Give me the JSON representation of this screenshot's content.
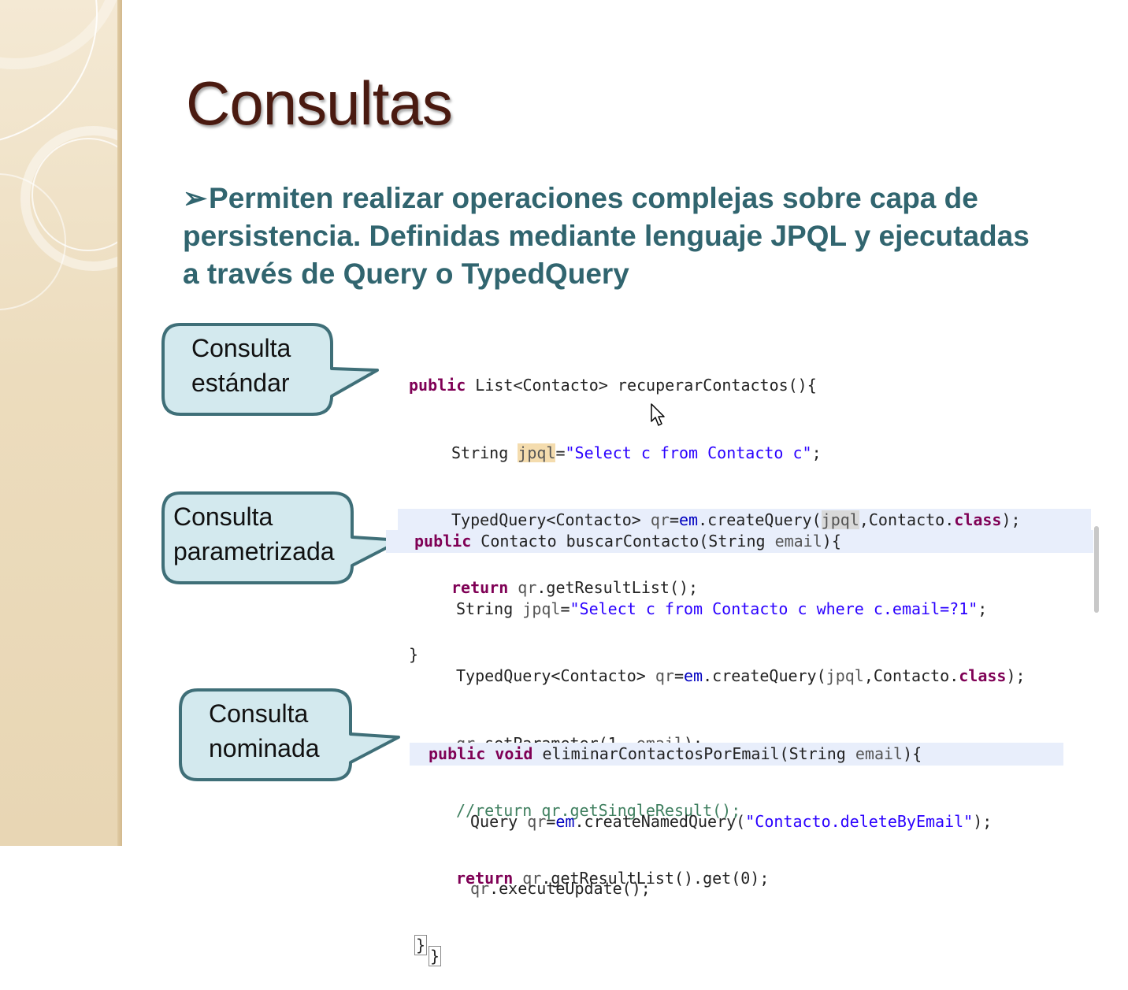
{
  "slide": {
    "title": "Consultas",
    "bullet_arrow": "➢",
    "bullet_text": "Permiten realizar operaciones complejas sobre capa de persistencia. Definidas mediante lenguaje JPQL y ejecutadas a través de Query o TypedQuery"
  },
  "callouts": [
    {
      "line1": "Consulta",
      "line2": "estándar"
    },
    {
      "line1": "Consulta",
      "line2": "parametrizada"
    },
    {
      "line1": "Consulta",
      "line2": "nominada"
    }
  ],
  "code_standard": {
    "l1_kw": "public",
    "l1_rest": " List<Contacto> recuperarContactos(){",
    "l2_a": "String ",
    "l2_var": "jpql",
    "l2_b": "=",
    "l2_str": "\"Select c from Contacto c\"",
    "l2_c": ";",
    "l3_a": "TypedQuery<Contacto> ",
    "l3_qr": "qr",
    "l3_b": "=",
    "l3_em": "em",
    "l3_c": ".createQuery(",
    "l3_var": "jpql",
    "l3_d": ",Contacto.",
    "l3_kw": "class",
    "l3_e": ");",
    "l4_kw": "return",
    "l4_qr": " qr",
    "l4_rest": ".getResultList();",
    "l5": "}"
  },
  "code_param": {
    "l1_kw": "public",
    "l1_a": " Contacto buscarContacto(String ",
    "l1_var": "email",
    "l1_b": "){",
    "l2_a": "String ",
    "l2_var": "jpql",
    "l2_b": "=",
    "l2_str": "\"Select c from Contacto c where c.email=?1\"",
    "l2_c": ";",
    "l3_a": "TypedQuery<Contacto> ",
    "l3_qr": "qr",
    "l3_b": "=",
    "l3_em": "em",
    "l3_c": ".createQuery(",
    "l3_var": "jpql",
    "l3_d": ",Contacto.",
    "l3_kw": "class",
    "l3_e": ");",
    "l4_qr": "qr",
    "l4_a": ".setParameter(1, ",
    "l4_var": "email",
    "l4_b": ");",
    "l5_cmt": "//return qr.getSingleResult();",
    "l6_kw": "return",
    "l6_qr": " qr",
    "l6_rest": ".getResultList().get(0);",
    "l7": "}"
  },
  "code_named": {
    "l1_kw1": "public",
    "l1_kw2": "void",
    "l1_a": " eliminarContactosPorEmail(String ",
    "l1_var": "email",
    "l1_b": "){",
    "l2_a": "Query ",
    "l2_qr": "qr",
    "l2_b": "=",
    "l2_em": "em",
    "l2_c": ".createNamedQuery(",
    "l2_str": "\"Contacto.deleteByEmail\"",
    "l2_d": ");",
    "l3_qr": "qr",
    "l3_rest": ".executeUpdate();",
    "l4": "}"
  },
  "colors": {
    "title": "#4a1a10",
    "bullet": "#31656f",
    "callout_fill": "#d3e9ee",
    "callout_stroke": "#3f6f78",
    "keyword": "#7f0055",
    "string": "#2a00ff",
    "field": "#0000c0",
    "comment": "#3f7f5f"
  }
}
